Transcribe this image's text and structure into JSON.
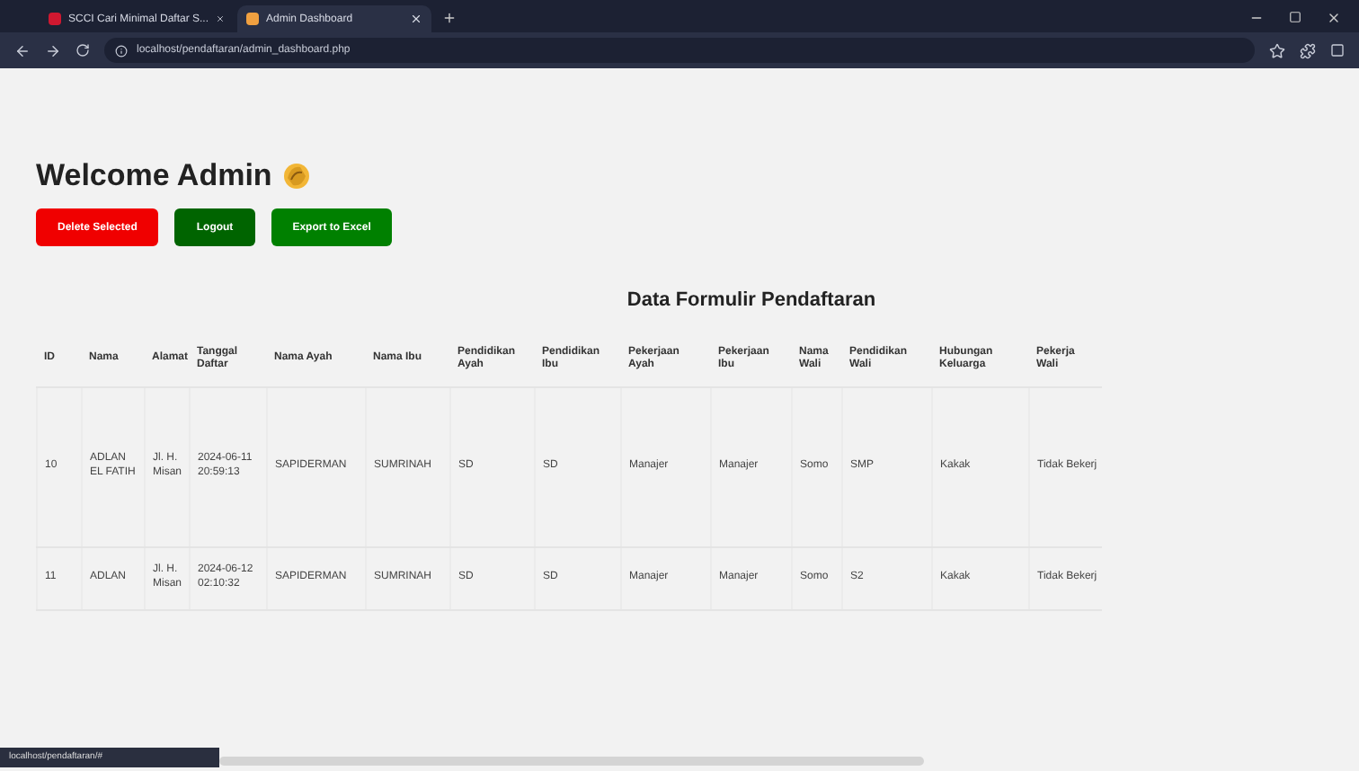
{
  "browser": {
    "tabs": [
      {
        "title": "SCCI Cari Minimal Daftar S...",
        "selected": false
      },
      {
        "title": "Admin Dashboard",
        "selected": true
      }
    ],
    "address": "localhost/pendaftaran/admin_dashboard.php"
  },
  "page": {
    "heading": "Welcome Admin",
    "buttons": [
      {
        "label": "Delete Selected",
        "kind": "danger"
      },
      {
        "label": "Logout",
        "kind": "dark"
      },
      {
        "label": "Export to Excel",
        "kind": "success"
      }
    ],
    "table": {
      "title": "Data Formulir Pendaftaran",
      "columns": [
        "ID",
        "Nama",
        "Alamat",
        "Tanggal Daftar",
        "Nama Ayah",
        "Nama Ibu",
        "Pendidikan Ayah",
        "Pendidikan Ibu",
        "Pekerjaan Ayah",
        "Pekerjaan Ibu",
        "Nama Wali",
        "Pendidikan Wali",
        "Hubungan Keluarga",
        "Pekerja Wali"
      ],
      "rows": [
        [
          "10",
          "ADLAN EL FATIH",
          "Jl. H. Misan",
          "2024-06-11 20:59:13",
          "SAPIDERMAN",
          "SUMRINAH",
          "SD",
          "SD",
          "Manajer",
          "Manajer",
          "Somo",
          "SMP",
          "Kakak",
          "Tidak Bekerj"
        ],
        [
          "11",
          "ADLAN",
          "Jl. H. Misan",
          "2024-06-12 02:10:32",
          "SAPIDERMAN",
          "SUMRINAH",
          "SD",
          "SD",
          "Manajer",
          "Manajer",
          "Somo",
          "S2",
          "Kakak",
          "Tidak Bekerj"
        ]
      ]
    }
  },
  "status_bar": {
    "link": "localhost/pendaftaran/#"
  }
}
